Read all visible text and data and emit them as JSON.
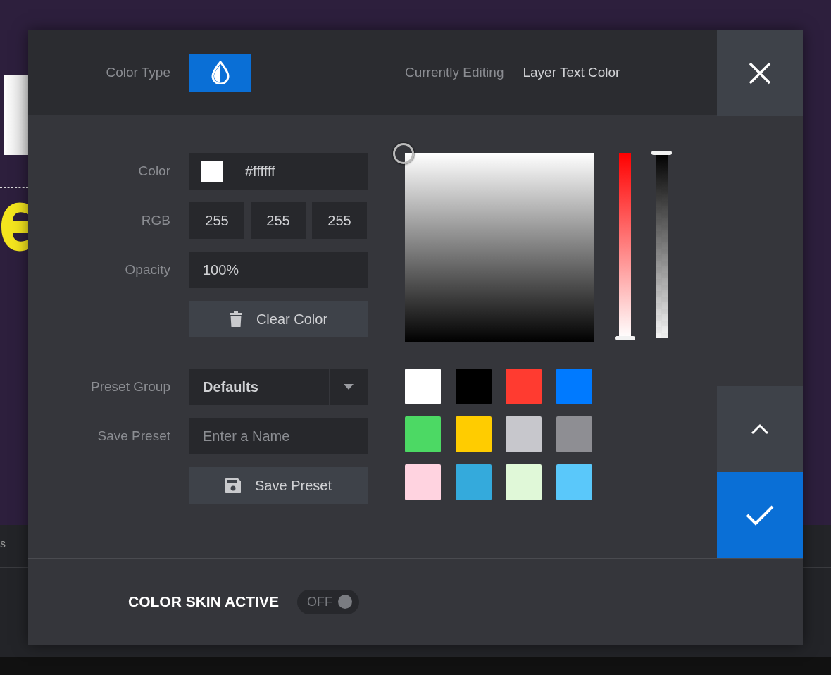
{
  "background": {
    "timeline_label": "s"
  },
  "header": {
    "color_type_label": "Color Type",
    "editing_label": "Currently Editing",
    "editing_value": "Layer Text Color"
  },
  "fields": {
    "color_label": "Color",
    "hex": "#ffffff",
    "rgb_label": "RGB",
    "rgb": [
      "255",
      "255",
      "255"
    ],
    "opacity_label": "Opacity",
    "opacity": "100%",
    "clear_button": "Clear Color",
    "preset_group_label": "Preset Group",
    "preset_group": "Defaults",
    "save_preset_label": "Save Preset",
    "save_preset_placeholder": "Enter a Name",
    "save_button": "Save Preset"
  },
  "picker": {
    "hue_slider": {
      "level": 0
    },
    "alpha_slider": {
      "level": 1
    }
  },
  "presets": [
    {
      "color": "#ffffff"
    },
    {
      "color": "#000000"
    },
    {
      "color": "#ff3b30"
    },
    {
      "color": "#007aff"
    },
    {
      "color": "#4cd964"
    },
    {
      "color": "#ffcc00"
    },
    {
      "color": "#c7c7cc"
    },
    {
      "color": "#8e8e93"
    },
    {
      "color": "#ffd3e0"
    },
    {
      "color": "#34aadc"
    },
    {
      "color": "#e0f8d8"
    },
    {
      "color": "#5ac8fa"
    }
  ],
  "footer": {
    "label": "COLOR SKIN ACTIVE",
    "toggle": {
      "on": false,
      "text": "OFF"
    }
  }
}
